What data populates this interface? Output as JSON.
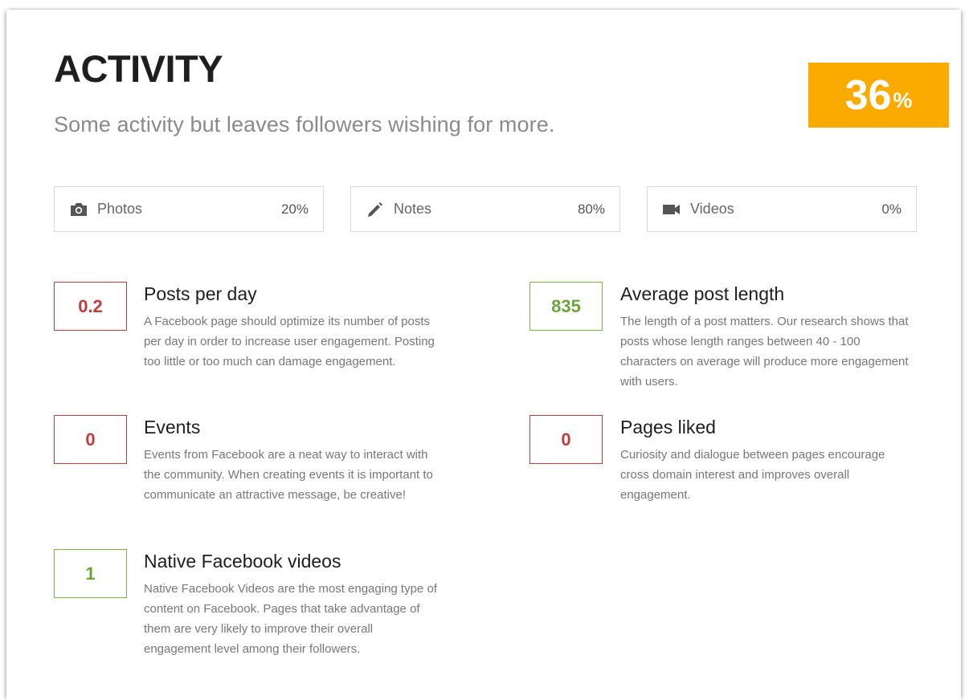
{
  "header": {
    "title": "ACTIVITY",
    "subtitle": "Some activity but leaves followers wishing for more.",
    "score_value": "36",
    "score_unit": "%",
    "score_color": "#fbab00"
  },
  "content_types": [
    {
      "label": "Photos",
      "value": "20%",
      "icon": "camera-icon"
    },
    {
      "label": "Notes",
      "value": "80%",
      "icon": "pencil-icon"
    },
    {
      "label": "Videos",
      "value": "0%",
      "icon": "video-camera-icon"
    }
  ],
  "metrics": [
    {
      "value": "0.2",
      "status": "bad",
      "title": "Posts per day",
      "description": "A Facebook page should optimize its number of posts per day in order to increase user engagement. Posting too little or too much can damage engagement."
    },
    {
      "value": "835",
      "status": "good",
      "title": "Average post length",
      "description": "The length of a post matters. Our research shows that posts whose length ranges between 40 - 100 characters on average will produce more engagement with users."
    },
    {
      "value": "0",
      "status": "bad",
      "title": "Events",
      "description": "Events from Facebook are a neat way to interact with the community. When creating events it is important to communicate an attractive message, be creative!"
    },
    {
      "value": "0",
      "status": "bad",
      "title": "Pages liked",
      "description": "Curiosity and dialogue between pages encourage cross domain interest and improves overall engagement."
    },
    {
      "value": "1",
      "status": "good",
      "title": "Native Facebook videos",
      "description": "Native Facebook Videos are the most engaging type of content on Facebook. Pages that take advantage of them are very likely to improve their overall engagement level among their followers."
    }
  ],
  "colors": {
    "bad": "#c23c3c",
    "good": "#7cb342"
  }
}
